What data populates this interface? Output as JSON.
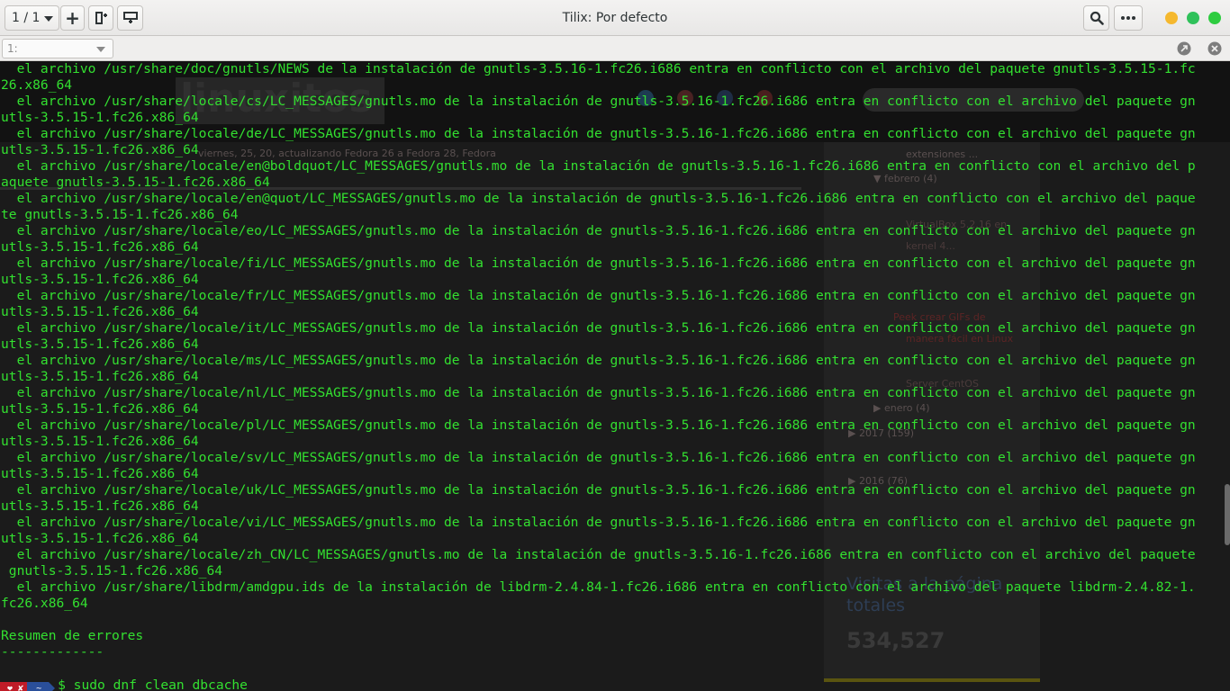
{
  "window": {
    "title": "Tilix: Por defecto"
  },
  "toolbar": {
    "session_label": "1 / 1",
    "add_label": "+",
    "terminal_selector_value": "1:"
  },
  "background_page": {
    "logo": "linuxitos",
    "visits_heading_1": "Visitas a la página",
    "visits_heading_2": "totales",
    "visits_count": "534,527",
    "archive_items": [
      "extensiones ...",
      "▼  febrero (4)",
      "VirtualBox 5.2.16 en",
      "kernel 4...",
      "Peek crear GIFs de",
      "manera fácil en Linux",
      "Server CentOS",
      "▶  enero (4)",
      "▶  2017 (159)",
      "▶  2016 (76)"
    ],
    "meta_line": "viernes, 25, 20, actualizando Fedora 26 a Fedora 28, Fedora"
  },
  "terminal": {
    "lines": [
      "  el archivo /usr/share/doc/gnutls/NEWS de la instalación de gnutls-3.5.16-1.fc26.i686 entra en conflicto con el archivo del paquete gnutls-3.5.15-1.fc",
      "26.x86_64",
      "  el archivo /usr/share/locale/cs/LC_MESSAGES/gnutls.mo de la instalación de gnutls-3.5.16-1.fc26.i686 entra en conflicto con el archivo del paquete gn",
      "utls-3.5.15-1.fc26.x86_64",
      "  el archivo /usr/share/locale/de/LC_MESSAGES/gnutls.mo de la instalación de gnutls-3.5.16-1.fc26.i686 entra en conflicto con el archivo del paquete gn",
      "utls-3.5.15-1.fc26.x86_64",
      "  el archivo /usr/share/locale/en@boldquot/LC_MESSAGES/gnutls.mo de la instalación de gnutls-3.5.16-1.fc26.i686 entra en conflicto con el archivo del p",
      "aquete gnutls-3.5.15-1.fc26.x86_64",
      "  el archivo /usr/share/locale/en@quot/LC_MESSAGES/gnutls.mo de la instalación de gnutls-3.5.16-1.fc26.i686 entra en conflicto con el archivo del paque",
      "te gnutls-3.5.15-1.fc26.x86_64",
      "  el archivo /usr/share/locale/eo/LC_MESSAGES/gnutls.mo de la instalación de gnutls-3.5.16-1.fc26.i686 entra en conflicto con el archivo del paquete gn",
      "utls-3.5.15-1.fc26.x86_64",
      "  el archivo /usr/share/locale/fi/LC_MESSAGES/gnutls.mo de la instalación de gnutls-3.5.16-1.fc26.i686 entra en conflicto con el archivo del paquete gn",
      "utls-3.5.15-1.fc26.x86_64",
      "  el archivo /usr/share/locale/fr/LC_MESSAGES/gnutls.mo de la instalación de gnutls-3.5.16-1.fc26.i686 entra en conflicto con el archivo del paquete gn",
      "utls-3.5.15-1.fc26.x86_64",
      "  el archivo /usr/share/locale/it/LC_MESSAGES/gnutls.mo de la instalación de gnutls-3.5.16-1.fc26.i686 entra en conflicto con el archivo del paquete gn",
      "utls-3.5.15-1.fc26.x86_64",
      "  el archivo /usr/share/locale/ms/LC_MESSAGES/gnutls.mo de la instalación de gnutls-3.5.16-1.fc26.i686 entra en conflicto con el archivo del paquete gn",
      "utls-3.5.15-1.fc26.x86_64",
      "  el archivo /usr/share/locale/nl/LC_MESSAGES/gnutls.mo de la instalación de gnutls-3.5.16-1.fc26.i686 entra en conflicto con el archivo del paquete gn",
      "utls-3.5.15-1.fc26.x86_64",
      "  el archivo /usr/share/locale/pl/LC_MESSAGES/gnutls.mo de la instalación de gnutls-3.5.16-1.fc26.i686 entra en conflicto con el archivo del paquete gn",
      "utls-3.5.15-1.fc26.x86_64",
      "  el archivo /usr/share/locale/sv/LC_MESSAGES/gnutls.mo de la instalación de gnutls-3.5.16-1.fc26.i686 entra en conflicto con el archivo del paquete gn",
      "utls-3.5.15-1.fc26.x86_64",
      "  el archivo /usr/share/locale/uk/LC_MESSAGES/gnutls.mo de la instalación de gnutls-3.5.16-1.fc26.i686 entra en conflicto con el archivo del paquete gn",
      "utls-3.5.15-1.fc26.x86_64",
      "  el archivo /usr/share/locale/vi/LC_MESSAGES/gnutls.mo de la instalación de gnutls-3.5.16-1.fc26.i686 entra en conflicto con el archivo del paquete gn",
      "utls-3.5.15-1.fc26.x86_64",
      "  el archivo /usr/share/locale/zh_CN/LC_MESSAGES/gnutls.mo de la instalación de gnutls-3.5.16-1.fc26.i686 entra en conflicto con el archivo del paquete",
      " gnutls-3.5.15-1.fc26.x86_64",
      "  el archivo /usr/share/libdrm/amdgpu.ids de la instalación de libdrm-2.4.84-1.fc26.i686 entra en conflicto con el archivo del paquete libdrm-2.4.82-1.",
      "fc26.x86_64",
      "",
      "Resumen de errores",
      "-------------"
    ],
    "prompt": {
      "status_segment": "❤ ✘",
      "dir_segment": "~",
      "command": "$ sudo dnf clean dbcache"
    }
  },
  "colors": {
    "terminal_text": "#33e030",
    "terminal_bg": "#1b1b1b",
    "close_button": "#2ecc40",
    "minimize_button": "#f5b82e",
    "maximize_button": "#2fc15a"
  }
}
